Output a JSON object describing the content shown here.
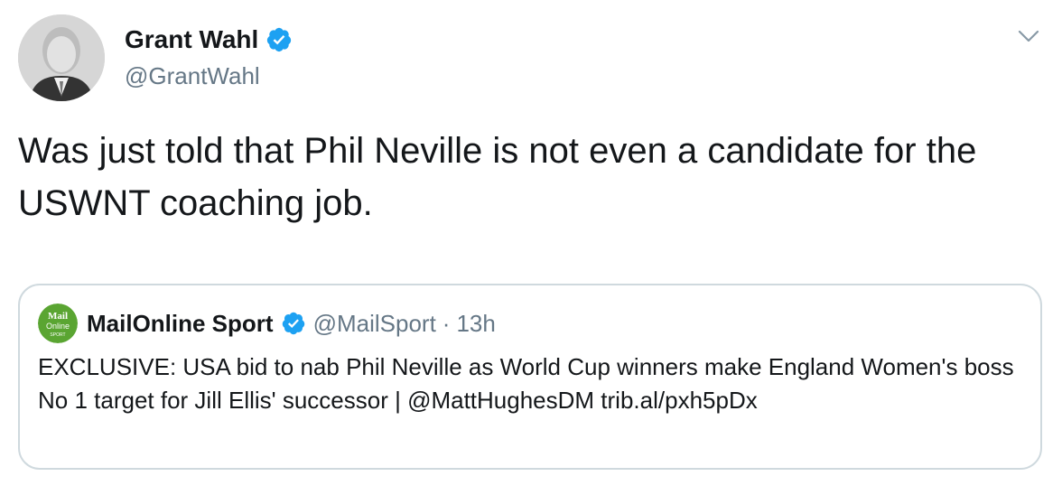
{
  "tweet": {
    "display_name": "Grant Wahl",
    "handle": "@GrantWahl",
    "text": "Was just told that Phil Neville is not even a candidate for the USWNT coaching job."
  },
  "quoted_tweet": {
    "display_name": "MailOnline Sport",
    "handle": "@MailSport",
    "separator": "·",
    "time": "13h",
    "text": "EXCLUSIVE: USA bid to nab Phil Neville as World Cup winners make England Women's boss No 1 target for Jill Ellis' successor | @MattHughesDM trib.al/pxh5pDx",
    "avatar_logo_text": [
      "Mail",
      "Online",
      "SPORT"
    ]
  },
  "colors": {
    "text": "#14171a",
    "secondary": "#657786",
    "verified": "#1da1f2",
    "border": "#cfd9de",
    "mail_green": "#5aa532"
  },
  "icons": {
    "verified": "verified-badge-icon",
    "caret": "chevron-down-icon"
  }
}
